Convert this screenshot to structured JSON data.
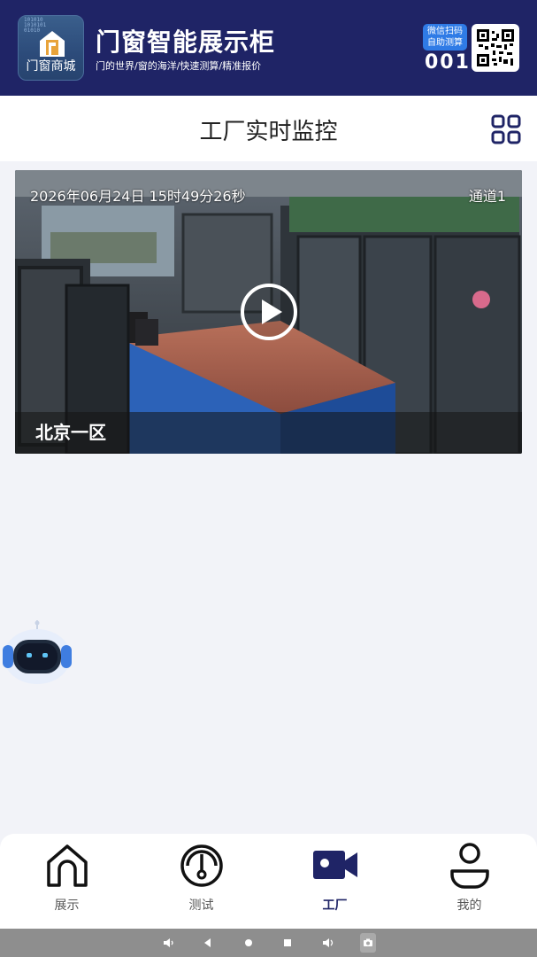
{
  "topbar": {
    "logo_bits": "101010\n1010101\n01010",
    "logo_text": "门窗商城",
    "title": "门窗智能展示柜",
    "subtitle": "门的世界/窗的海洋/快速测算/精准报价",
    "badge_line1": "微信扫码",
    "badge_line2": "自助测算",
    "code": "001",
    "colors": {
      "bar": "#1f2466",
      "badge": "#2f7be6"
    }
  },
  "header": {
    "title": "工厂实时监控",
    "menu_icon": "grid-icon"
  },
  "video": {
    "timestamp": "2026年06月24日 15时49分26秒",
    "channel": "通道1",
    "location": "北京一区",
    "play_icon": "play-icon"
  },
  "assistant": {
    "icon": "robot-icon"
  },
  "tabbar": {
    "active_color": "#1f2466",
    "tabs": [
      {
        "label": "展示",
        "icon": "home-icon",
        "active": false
      },
      {
        "label": "测试",
        "icon": "gauge-icon",
        "active": false
      },
      {
        "label": "工厂",
        "icon": "video-camera-icon",
        "active": true
      },
      {
        "label": "我的",
        "icon": "user-icon",
        "active": false
      }
    ]
  },
  "system_nav": {
    "icons": [
      "volume-down-icon",
      "back-icon",
      "home-circle-icon",
      "recents-icon",
      "volume-up-icon",
      "screenshot-icon"
    ]
  }
}
